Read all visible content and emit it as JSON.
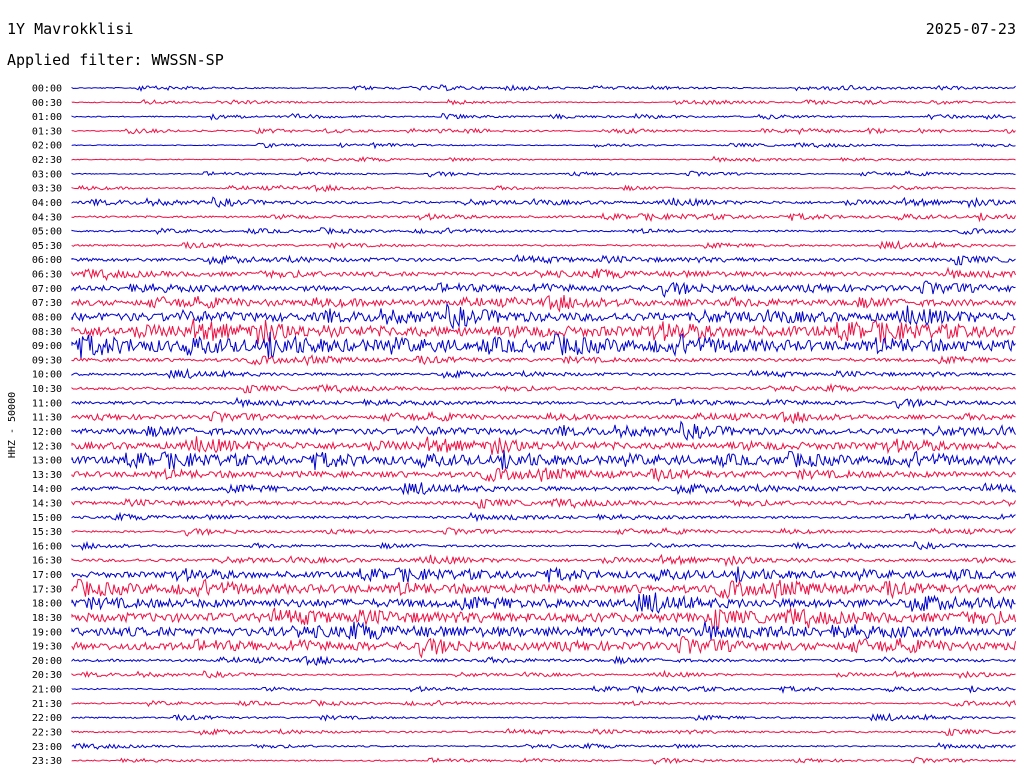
{
  "header": {
    "station": "1Y Mavrokklisi",
    "date": "2025-07-23",
    "filter": "Applied filter: WWSSN-SP"
  },
  "chart_data": {
    "type": "line",
    "ylabel": "HHZ - 50000",
    "rows": [
      "00:00",
      "00:30",
      "01:00",
      "01:30",
      "02:00",
      "02:30",
      "03:00",
      "03:30",
      "04:00",
      "04:30",
      "05:00",
      "05:30",
      "06:00",
      "06:30",
      "07:00",
      "07:30",
      "08:00",
      "08:30",
      "09:00",
      "09:30",
      "10:00",
      "10:30",
      "11:00",
      "11:30",
      "12:00",
      "12:30",
      "13:00",
      "13:30",
      "14:00",
      "14:30",
      "15:00",
      "15:30",
      "16:00",
      "16:30",
      "17:00",
      "17:30",
      "18:00",
      "18:30",
      "19:00",
      "19:30",
      "20:00",
      "20:30",
      "21:00",
      "21:30",
      "22:00",
      "22:30",
      "23:00",
      "23:30"
    ],
    "activity": [
      0.6,
      0.5,
      0.7,
      0.6,
      0.5,
      0.6,
      0.6,
      0.7,
      1.5,
      1.2,
      1.0,
      1.1,
      2.0,
      2.5,
      3.2,
      3.5,
      5.0,
      6.0,
      6.5,
      2.0,
      1.5,
      1.5,
      1.8,
      2.2,
      3.5,
      4.0,
      4.5,
      3.5,
      2.5,
      2.0,
      1.5,
      1.2,
      1.0,
      1.8,
      3.5,
      5.0,
      5.0,
      5.5,
      5.5,
      4.5,
      1.5,
      0.8,
      0.8,
      0.8,
      0.9,
      1.0,
      0.8,
      0.8
    ],
    "colors": {
      "odd": "#0000cc",
      "even": "#ee1144"
    }
  }
}
